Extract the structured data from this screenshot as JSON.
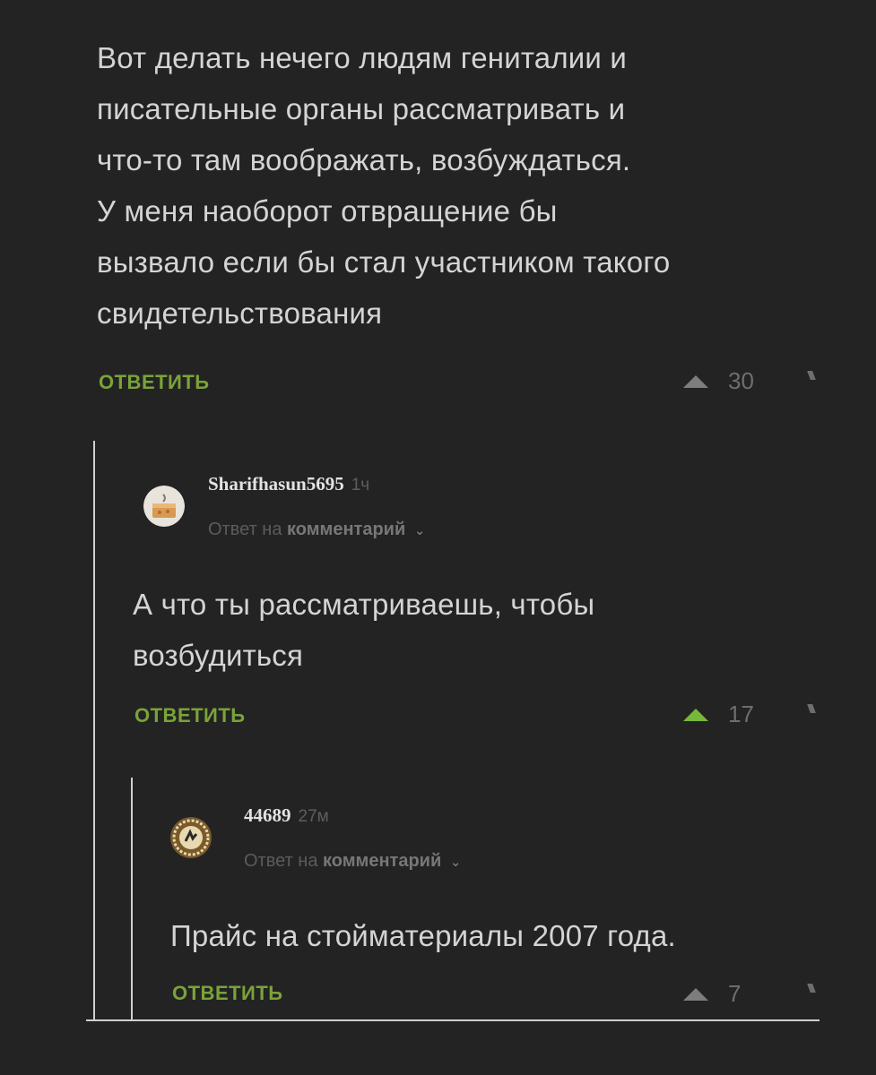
{
  "comments": [
    {
      "text_lines": [
        "Вот делать нечего людям гениталии и",
        "писательные органы рассматривать и",
        "что-то там воображать, возбуждаться.",
        "У меня наоборот отвращение бы",
        "вызвало если бы стал участником такого",
        "свидетельствования"
      ],
      "reply_label": "ОТВЕТИТЬ",
      "votes": "30"
    },
    {
      "username": "Sharifhasun5695",
      "time": "1ч",
      "reply_to_prefix": "Ответ на",
      "reply_to_target": "комментарий",
      "text_lines": [
        "А что ты рассматриваешь, чтобы",
        "возбудиться"
      ],
      "reply_label": "ОТВЕТИТЬ",
      "votes": "17"
    },
    {
      "username": "44689",
      "time": "27м",
      "reply_to_prefix": "Ответ на",
      "reply_to_target": "комментарий",
      "text_lines": [
        "Прайс на стойматериалы 2007 года."
      ],
      "reply_label": "ОТВЕТИТЬ",
      "votes": "7"
    }
  ],
  "colors": {
    "background": "#232323",
    "accent_green": "#7aa33a",
    "upvote_active": "#77b83a"
  },
  "icons": [
    "upvote-arrow-icon",
    "downvote-arrow-icon",
    "chevron-down-icon"
  ]
}
